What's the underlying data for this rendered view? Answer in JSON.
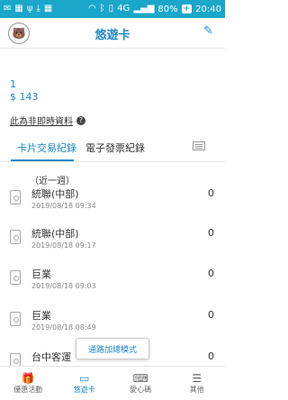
{
  "status_bar": {
    "battery": "80%",
    "time": "20:40",
    "network": "4G"
  },
  "header": {
    "title": "悠遊卡"
  },
  "summary": {
    "count": "1",
    "amount": "$ 143",
    "info_label": "此為非即時資料"
  },
  "tabs": [
    {
      "label": "卡片交易紀錄"
    },
    {
      "label": "電子發票紀錄"
    }
  ],
  "range_label": "（近一週）",
  "transactions": [
    {
      "store": "統聯(中部)",
      "time": "2019/08/18  09:34",
      "value": "0"
    },
    {
      "store": "統聯(中部)",
      "time": "2019/08/18  09:17",
      "value": "0"
    },
    {
      "store": "巨業",
      "time": "2019/08/18  09:03",
      "value": "0"
    },
    {
      "store": "巨業",
      "time": "2019/08/18  08:49",
      "value": "0"
    },
    {
      "store": "台中客運",
      "time": "",
      "value": "0"
    }
  ],
  "mode_button": "通路加總模式",
  "bottom_nav": [
    {
      "label": "優惠活動",
      "icon": "gift-icon"
    },
    {
      "label": "悠遊卡",
      "icon": "card-icon"
    },
    {
      "label": "愛心碼",
      "icon": "keyboard-icon"
    },
    {
      "label": "其他",
      "icon": "menu-icon"
    }
  ],
  "colors": {
    "accent": "#1e88c9",
    "status_bar": "#1aa7c9"
  }
}
